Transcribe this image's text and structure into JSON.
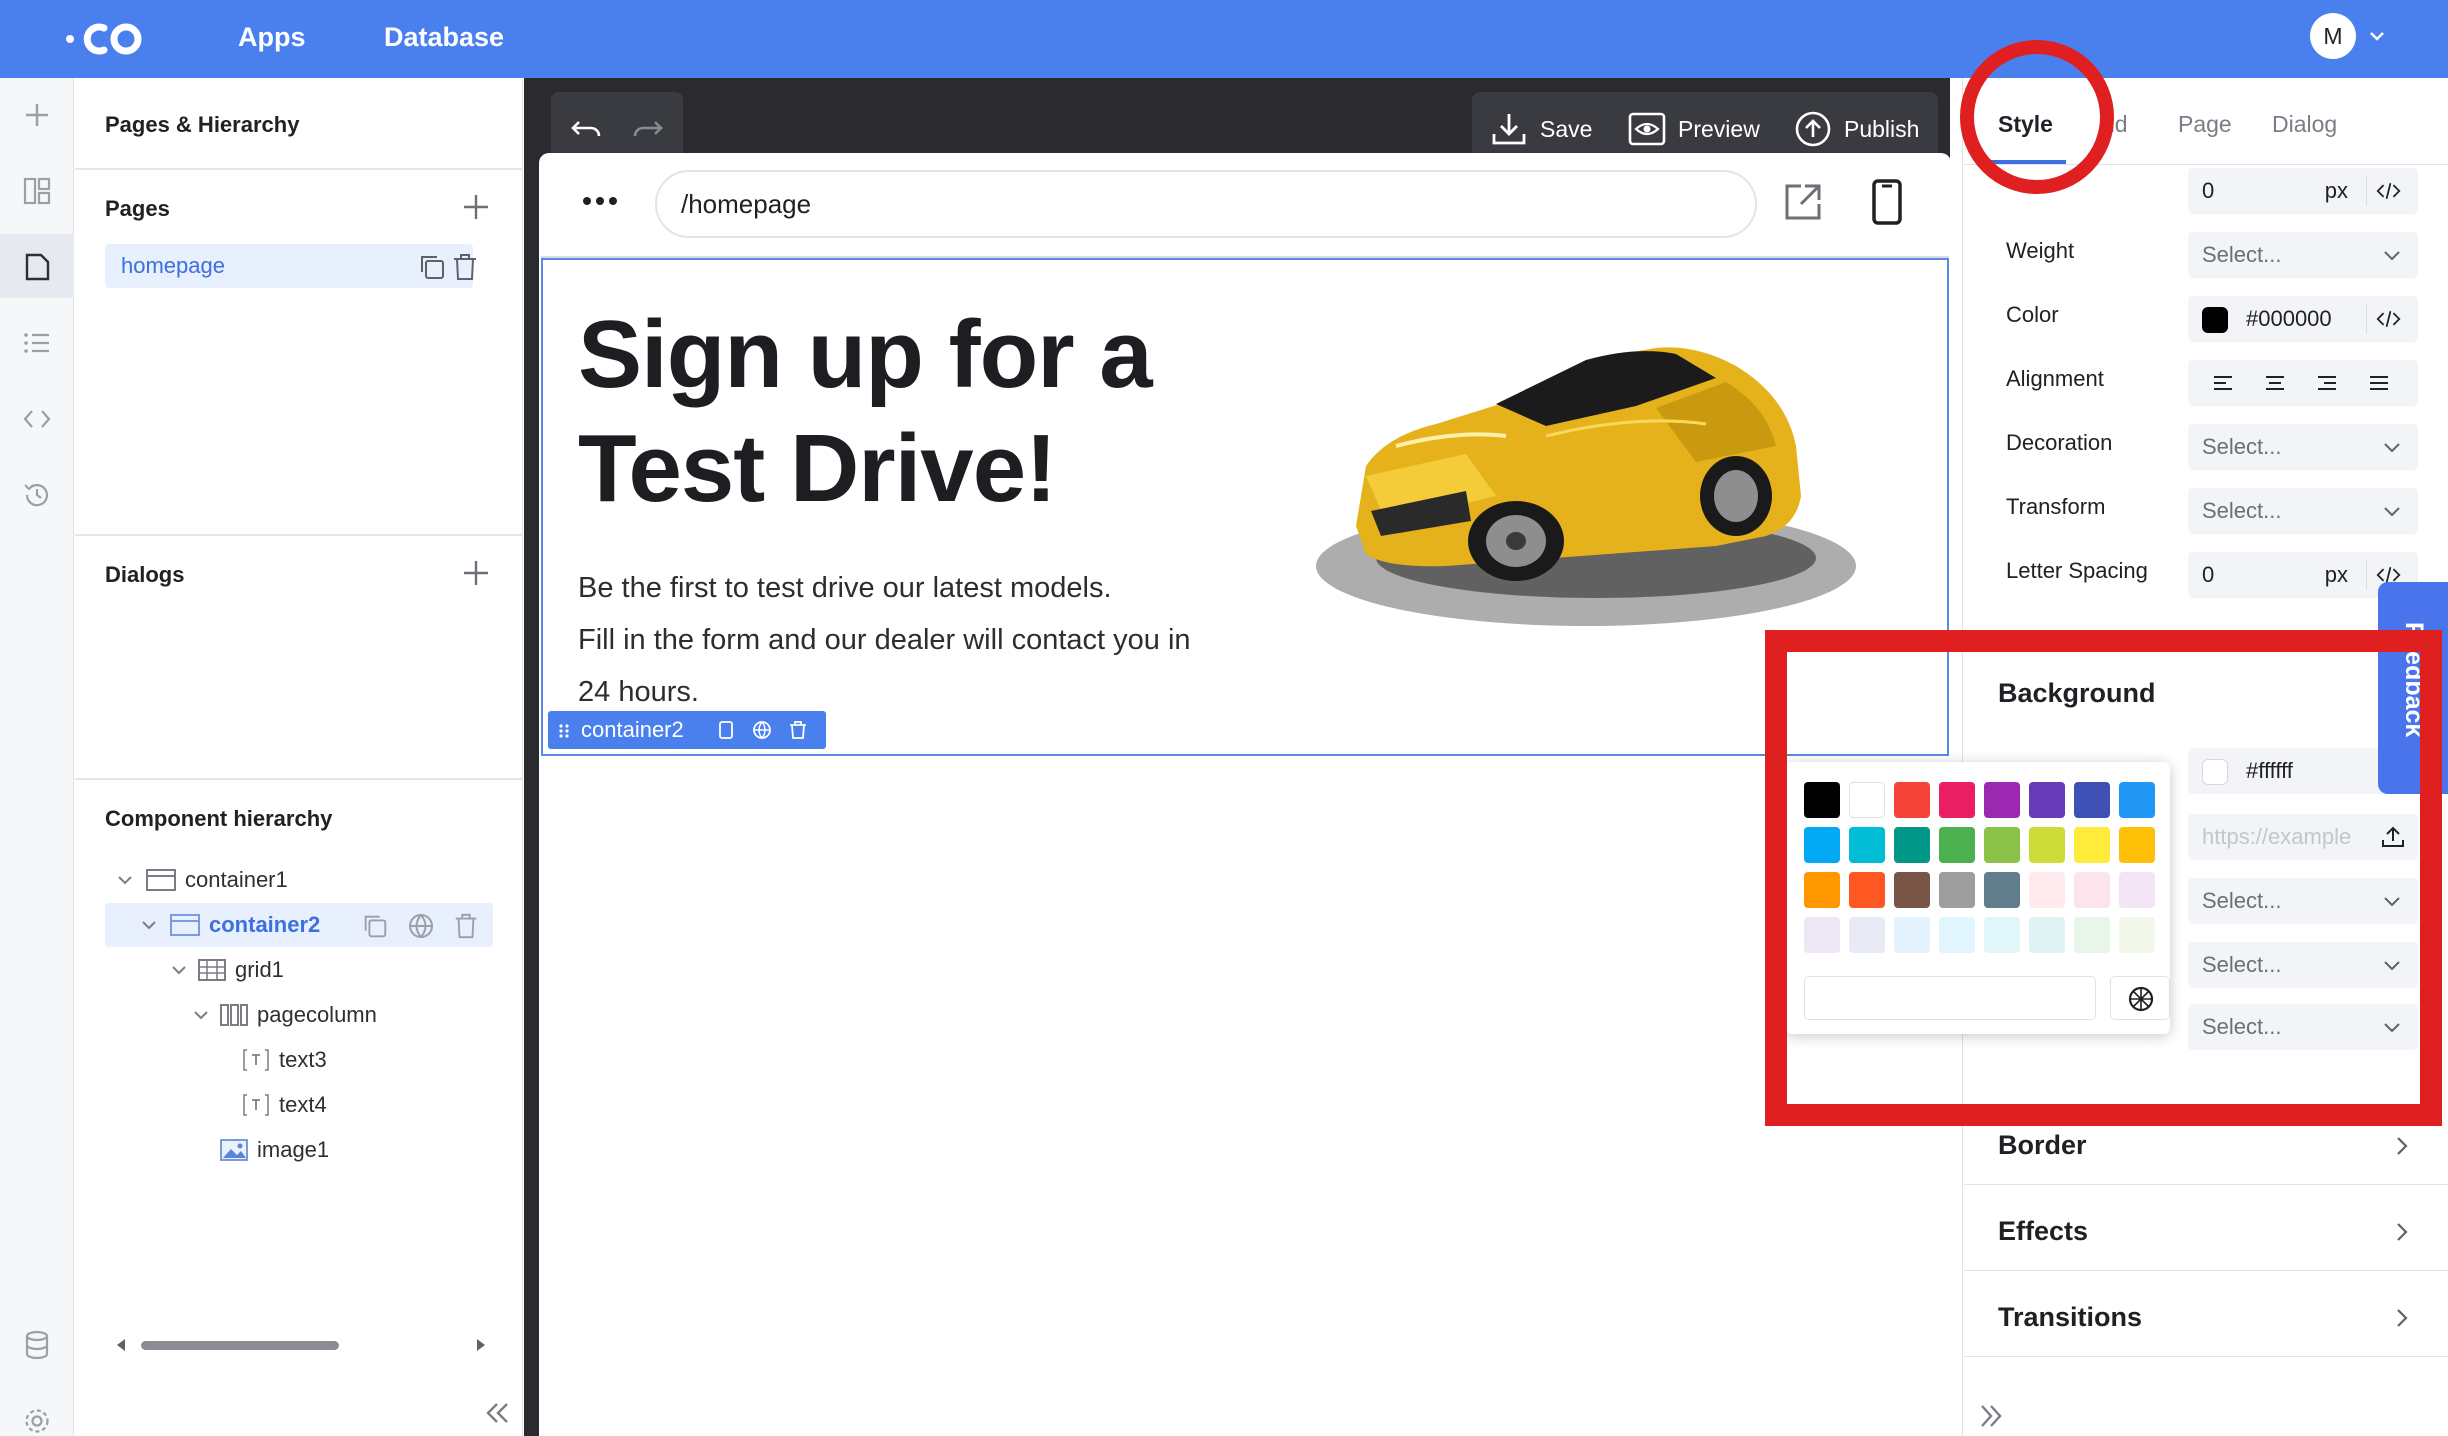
{
  "topbar": {
    "logo": "·CO",
    "nav": [
      "Apps",
      "Database"
    ],
    "avatar_initial": "M"
  },
  "pages_panel": {
    "title": "Pages & Hierarchy",
    "pages_heading": "Pages",
    "pages": [
      "homepage"
    ],
    "dialogs_heading": "Dialogs",
    "component_heading": "Component hierarchy",
    "tree": [
      {
        "label": "container1",
        "icon": "container-icon",
        "level": 0,
        "expanded": true
      },
      {
        "label": "container2",
        "icon": "container-icon",
        "level": 1,
        "expanded": true,
        "selected": true
      },
      {
        "label": "grid1",
        "icon": "grid-icon",
        "level": 2,
        "expanded": true
      },
      {
        "label": "pagecolumn",
        "icon": "column-icon",
        "level": 3,
        "expanded": true
      },
      {
        "label": "text3",
        "icon": "text-icon",
        "level": 4
      },
      {
        "label": "text4",
        "icon": "text-icon",
        "level": 4
      },
      {
        "label": "image1",
        "icon": "image-icon",
        "level": 3
      }
    ]
  },
  "canvas": {
    "actions": [
      "Save",
      "Preview",
      "Publish"
    ],
    "url": "/homepage",
    "headline": [
      "Sign up for a",
      "Test Drive!"
    ],
    "body": [
      "Be the first to test drive our latest models.",
      "Fill in the form and our dealer will contact you in",
      "24 hours."
    ],
    "container_tag": "container2"
  },
  "right_panel": {
    "tabs": [
      "Style",
      "nd",
      "Page",
      "Dialog"
    ],
    "active_tab": "Style",
    "size_value": "0",
    "size_unit": "px",
    "weight_label": "Weight",
    "weight_value": "Select...",
    "color_label": "Color",
    "color_value": "#000000",
    "alignment_label": "Alignment",
    "decoration_label": "Decoration",
    "decoration_value": "Select...",
    "transform_label": "Transform",
    "transform_value": "Select...",
    "letter_spacing_label": "Letter Spacing",
    "letter_spacing_value": "0",
    "letter_spacing_unit": "px",
    "background_heading": "Background",
    "background_color": "#ffffff",
    "background_image_placeholder": "https://example",
    "bg_select_1": "Select...",
    "bg_select_2": "Select...",
    "bg_select_3": "Select...",
    "sections": [
      "Border",
      "Effects",
      "Transitions"
    ],
    "feedback_label": "Feedback"
  },
  "color_picker": {
    "swatches": [
      "#000000",
      "#ffffff",
      "#f44336",
      "#e91e63",
      "#9c27b0",
      "#673ab7",
      "#3f51b5",
      "#2196f3",
      "#03a9f4",
      "#00bcd4",
      "#009688",
      "#4caf50",
      "#8bc34a",
      "#cddc39",
      "#ffeb3b",
      "#ffc107",
      "#ff9800",
      "#ff5722",
      "#795548",
      "#9e9e9e",
      "#607d8b",
      "#ffebee",
      "#fce4ec",
      "#f3e5f5",
      "#ede7f6",
      "#e8eaf6",
      "#e3f2fd",
      "#e1f5fe",
      "#e0f7fa",
      "#e0f2f1",
      "#e8f5e9",
      "#f1f8e9"
    ]
  },
  "colors": {
    "accent": "#4a7fee",
    "annotation_red": "#e02020",
    "canvas_dark": "#2b2b2f"
  }
}
